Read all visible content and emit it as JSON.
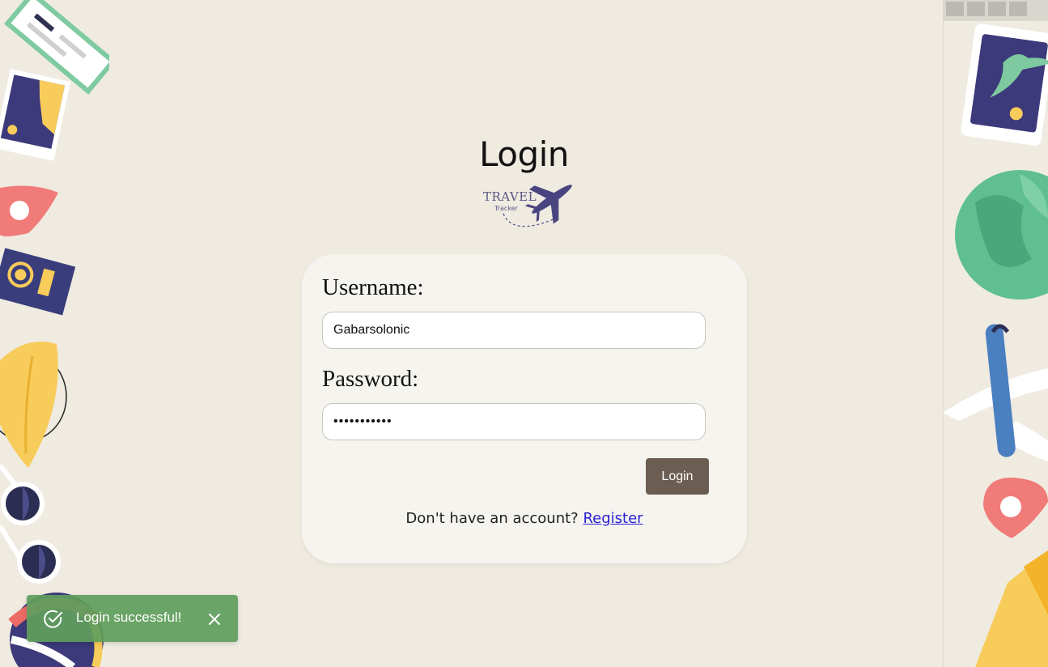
{
  "header": {
    "title": "Login",
    "logo_word": "TRAVEL",
    "logo_sub": "Tracker"
  },
  "form": {
    "username_label": "Username:",
    "username_value": "Gabarsolonic",
    "password_label": "Password:",
    "password_value": "•••••••••••",
    "login_label": "Login",
    "register_prompt": "Don't have an account?",
    "register_link": "Register"
  },
  "toast": {
    "message": "Login successful!",
    "icon": "check-circle-icon",
    "close_icon": "close-icon"
  },
  "colors": {
    "background": "#efebe1",
    "card": "#f6f4ef",
    "button": "#6b5d51",
    "toast": "#609e5c",
    "link": "#2a1fd0"
  }
}
